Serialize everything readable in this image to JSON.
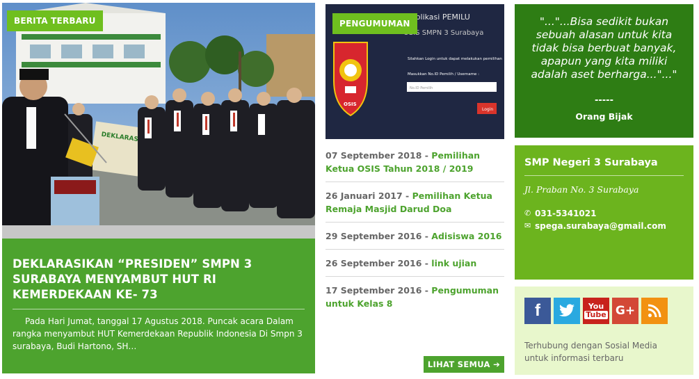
{
  "news": {
    "tag": "BERITA TERBARU",
    "title": "DEKLARASIKAN “PRESIDEN” SMPN 3 SURABAYA MENYAMBUT HUT RI KEMERDEKAAN KE- 73",
    "excerpt": "Pada Hari Jumat, tanggal 17 Agustus 2018. Puncak acara Dalam rangka menyambut HUT Kemerdekaan Republik Indonesia Di Smpn 3 surabaya, Budi Hartono, SH…",
    "photo_banner": "DEKLARASI PRESIDEN"
  },
  "announcements": {
    "tag": "PENGUMUMAN",
    "image": {
      "heading_line1": "Aplikasi PEMILU",
      "heading_line2": "OSIS SMPN 3 Surabaya",
      "login_prompt": "Silahkan Login untuk dapat melakukan pemilihan",
      "field_label": "Masukkan No.ID Pemilih / Username :",
      "field_placeholder": "No.ID Pemilih",
      "login_button": "Login",
      "logo_text": "OSIS"
    },
    "items": [
      {
        "date": "07 September 2018",
        "title": "Pemilihan Ketua OSIS Tahun 2018 / 2019"
      },
      {
        "date": "26 Januari 2017",
        "title": "Pemilihan Ketua Remaja Masjid Darud Doa"
      },
      {
        "date": "29 September 2016",
        "title": "Adisiswa 2016"
      },
      {
        "date": "26 September 2016",
        "title": "link ujian"
      },
      {
        "date": "17 September 2016",
        "title": "Pengumuman untuk Kelas 8"
      }
    ],
    "see_all": "LIHAT SEMUA"
  },
  "quote": {
    "text": "\"...\"...Bisa sedikit bukan sebuah alasan untuk kita tidak bisa berbuat banyak, apapun yang kita miliki adalah aset berharga...\"...\"",
    "dash": "-----",
    "author": "Orang Bijak"
  },
  "school": {
    "name": "SMP Negeri 3 Surabaya",
    "address": "Jl. Praban No. 3 Surabaya",
    "phone": "031-5341021",
    "email": "spega.surabaya@gmail.com"
  },
  "social": {
    "icons": [
      "facebook-icon",
      "twitter-icon",
      "youtube-icon",
      "google-plus-icon",
      "rss-icon"
    ],
    "youtube_line1": "You",
    "youtube_line2": "Tube",
    "text": "Terhubung dengan Sosial Media untuk informasi terbaru"
  },
  "colors": {
    "green_dark": "#2e7d14",
    "green": "#4da32e",
    "green_light": "#6cb41e",
    "tag": "#6fbf1f",
    "social_bg": "#e8f7cc"
  }
}
